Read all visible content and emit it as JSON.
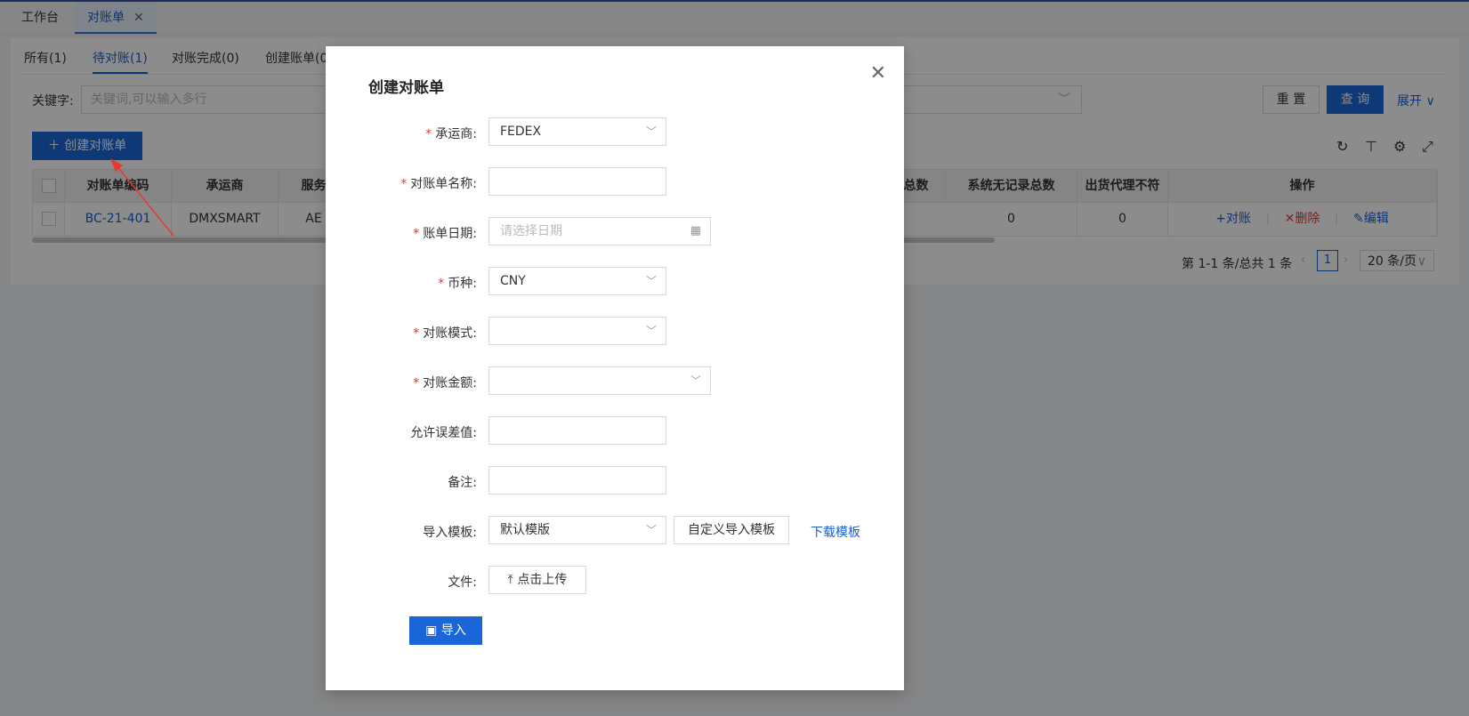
{
  "tabs": [
    {
      "label": "工作台"
    },
    {
      "label": "对账单",
      "close": "✕"
    }
  ],
  "subtabs": [
    "所有(1)",
    "待对账(1)",
    "对账完成(0)",
    "创建账单(0"
  ],
  "filter": {
    "keyword_label": "关键字:",
    "keyword_placeholder": "关键词,可以输入多行",
    "reset_label": "重 置",
    "query_label": "查 询",
    "expand_label": "展开"
  },
  "toolbar": {
    "create_label": "创建对账单"
  },
  "table": {
    "headers": [
      "对账单编码",
      "承运商",
      "服务",
      "总数",
      "系统无记录总数",
      "出货代理不符",
      "操作"
    ],
    "row": {
      "code": "BC-21-401",
      "carrier": "DMXSMART",
      "service": "AE",
      "no_record": "0",
      "mismatch": "0",
      "actions": [
        "+对账",
        "✕删除",
        "✎编辑"
      ]
    }
  },
  "pagination": {
    "summary": "第 1-1 条/总共 1 条",
    "current": "1",
    "page_size": "20 条/页"
  },
  "modal": {
    "title": "创建对账单",
    "fields": {
      "carrier": {
        "label": "承运商:",
        "value": "FEDEX"
      },
      "name": {
        "label": "对账单名称:",
        "value": ""
      },
      "date": {
        "label": "账单日期:",
        "placeholder": "请选择日期"
      },
      "currency": {
        "label": "币种:",
        "value": "CNY"
      },
      "mode": {
        "label": "对账模式:",
        "value": ""
      },
      "amount": {
        "label": "对账金额:",
        "value": ""
      },
      "tolerance": {
        "label": "允许误差值:",
        "value": ""
      },
      "remark": {
        "label": "备注:",
        "value": ""
      },
      "template": {
        "label": "导入模板:",
        "value": "默认模版",
        "custom_label": "自定义导入模板",
        "download_label": "下载模板"
      },
      "file": {
        "label": "文件:",
        "upload_label": "点击上传"
      }
    },
    "import_label": "导入"
  }
}
